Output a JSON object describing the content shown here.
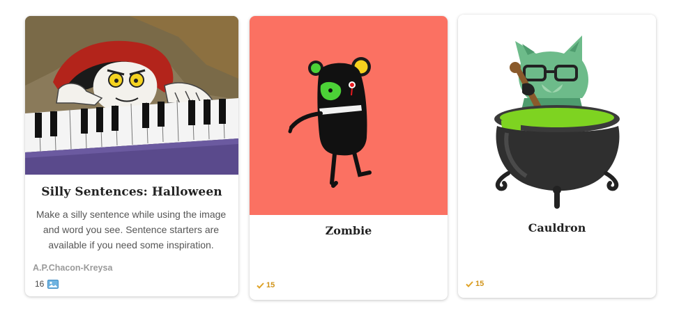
{
  "cards": [
    {
      "title": "Silly Sentences: Halloween",
      "description": "Make a silly sentence while using the image and word you see. Sentence starters are available if you need some inspiration.",
      "author": "A.P.Chacon-Kreysa",
      "count": "16",
      "image_icon": "image-icon"
    },
    {
      "title": "Zombie",
      "rating": "15",
      "rating_icon": "check-icon",
      "image_bg": "#fb7162"
    },
    {
      "title": "Cauldron",
      "rating": "15",
      "rating_icon": "check-icon"
    }
  ],
  "colors": {
    "accent_rating": "#e0a326",
    "zombie_bg": "#fb7162",
    "potion_green": "#7ed321"
  }
}
